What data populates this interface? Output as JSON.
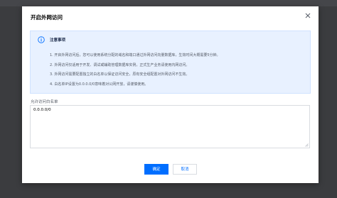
{
  "dialog": {
    "title": "开启外网访问"
  },
  "notice": {
    "title": "注意事项",
    "items": [
      "1. 开启外网访问后，您可以使用系统分配的域名和端口通过外网访问向量数据库，生效时间大概需要5分钟。",
      "2. 外网访问仅适用于开发、调试或辅助管理数据库实例，正式生产业务请使用内网访问。",
      "3. 外网访问需要配置独立的白名单以保证访问安全，原有安全组配置对外网访问不生效。",
      "4. 白名单IP设置为0.0.0.0/0意味着对公网开放，请谨慎使用。"
    ]
  },
  "whitelist": {
    "label": "允许访问白名单",
    "value": "0.0.0.0/0"
  },
  "buttons": {
    "confirm": "确定",
    "cancel": "取消"
  },
  "colors": {
    "primary": "#006eff",
    "notice_bg": "#e8f1ff",
    "overlay": "#3b3c3f"
  },
  "icons": {
    "close": "close-icon",
    "info": "info-icon",
    "resize": "resize-handle-icon"
  }
}
